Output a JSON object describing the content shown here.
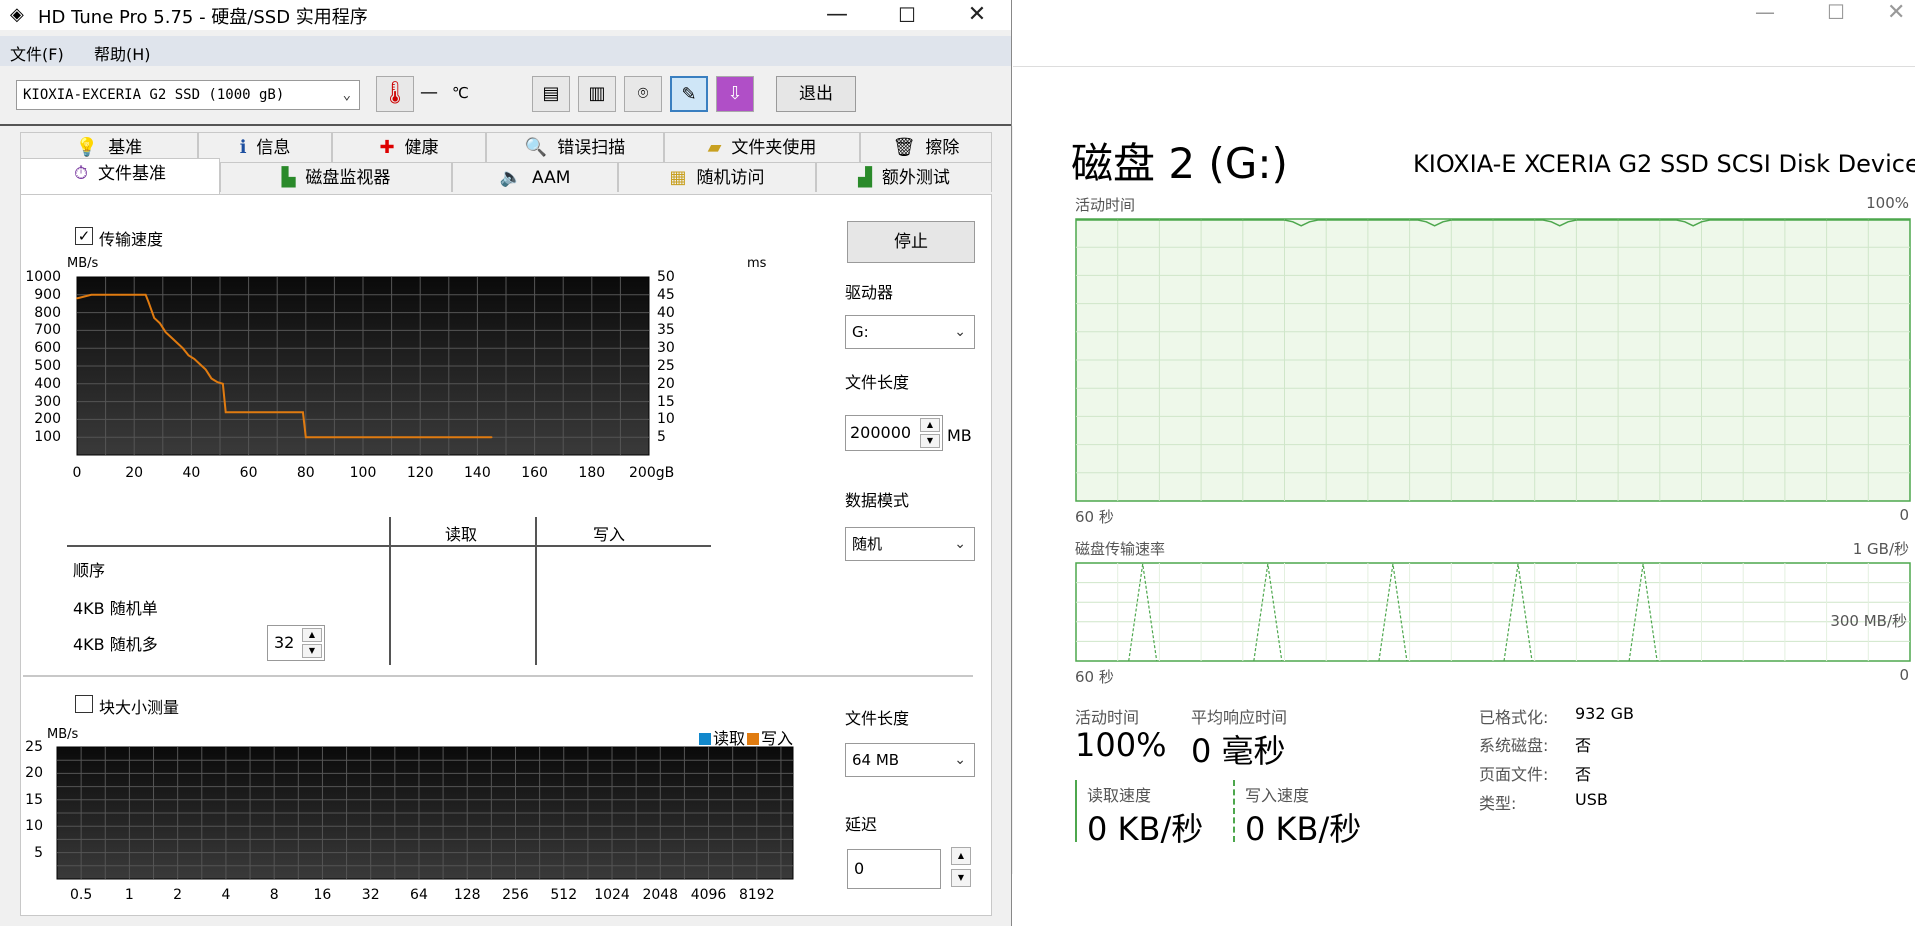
{
  "hdtune": {
    "title": "HD Tune Pro 5.75 - 硬盘/SSD 实用程序",
    "menu": [
      "文件(F)",
      "帮助(H)"
    ],
    "drive_select": "KIOXIA-EXCERIA G2 SSD (1000 gB)",
    "temp": "—",
    "exit_label": "退出",
    "tabs_row1": [
      {
        "label": "基准",
        "icon": "benchmark-icon"
      },
      {
        "label": "信息",
        "icon": "info-icon"
      },
      {
        "label": "健康",
        "icon": "health-icon"
      },
      {
        "label": "错误扫描",
        "icon": "error-scan-icon"
      },
      {
        "label": "文件夹使用",
        "icon": "folder-icon"
      },
      {
        "label": "擦除",
        "icon": "erase-icon"
      }
    ],
    "tabs_row2": [
      {
        "label": "文件基准",
        "icon": "file-benchmark-icon",
        "active": true
      },
      {
        "label": "磁盘监视器",
        "icon": "disk-monitor-icon"
      },
      {
        "label": "AAM",
        "icon": "speaker-icon"
      },
      {
        "label": "随机访问",
        "icon": "random-access-icon"
      },
      {
        "label": "额外测试",
        "icon": "extra-tests-icon"
      }
    ],
    "transfer_label": "传输速度",
    "transfer_checked": true,
    "chart_units_left": "MB/s",
    "chart_units_right": "ms",
    "y_ticks": [
      "1000",
      "900",
      "800",
      "700",
      "600",
      "500",
      "400",
      "300",
      "200",
      "100"
    ],
    "y2_ticks": [
      "50",
      "45",
      "40",
      "35",
      "30",
      "25",
      "20",
      "15",
      "10",
      "5"
    ],
    "x_ticks": [
      "0",
      "20",
      "40",
      "60",
      "80",
      "100",
      "120",
      "140",
      "160",
      "180",
      "200gB"
    ],
    "table_headers": [
      "读取",
      "写入"
    ],
    "rows": [
      "顺序",
      "4KB 随机单",
      "4KB 随机多"
    ],
    "queue_depth": "32",
    "stop_label": "停止",
    "drive_label": "驱动器",
    "drive_value": "G:",
    "file_length_label": "文件长度",
    "file_length_value": "200000",
    "file_length_unit": "MB",
    "data_mode_label": "数据模式",
    "data_mode_value": "随机",
    "block_label": "块大小测量",
    "block_checked": false,
    "block_units": "MB/s",
    "legend_read": "读取",
    "legend_write": "写入",
    "block_y_ticks": [
      "25",
      "20",
      "15",
      "10",
      "5"
    ],
    "block_x_ticks": [
      "0.5",
      "1",
      "2",
      "4",
      "8",
      "16",
      "32",
      "64",
      "128",
      "256",
      "512",
      "1024",
      "2048",
      "4096",
      "8192"
    ],
    "file_length2_label": "文件长度",
    "file_length2_value": "64 MB",
    "delay_label": "延迟",
    "delay_value": "0",
    "colors": {
      "write_line": "#e07b10",
      "read_legend": "#1188cc",
      "write_legend": "#e07b10"
    }
  },
  "chart_data": {
    "type": "line",
    "xlabel": "",
    "ylabel": "MB/s",
    "xlim": [
      0,
      200
    ],
    "ylim": [
      0,
      1000
    ],
    "series": [
      {
        "name": "写入",
        "x": [
          0,
          5,
          10,
          15,
          20,
          24,
          25,
          27,
          29,
          31,
          33,
          35,
          37,
          39,
          41,
          43,
          45,
          47,
          49,
          51,
          52,
          60,
          70,
          79,
          80,
          90,
          100,
          110,
          120,
          130,
          140,
          145
        ],
        "y": [
          880,
          900,
          900,
          900,
          900,
          900,
          860,
          770,
          740,
          690,
          660,
          630,
          600,
          560,
          540,
          510,
          480,
          430,
          410,
          400,
          240,
          240,
          240,
          240,
          100,
          100,
          100,
          100,
          100,
          100,
          100,
          100
        ]
      }
    ]
  },
  "taskmgr": {
    "disk_title": "磁盘 2 (G:)",
    "device_name": "KIOXIA-E XCERIA G2 SSD SCSI Disk Device",
    "activity_label": "活动时间",
    "activity_max": "100%",
    "time_left": "60 秒",
    "time_right": "0",
    "rate_label": "磁盘传输速率",
    "rate_max": "1 GB/秒",
    "rate_mid": "300 MB/秒",
    "time_left2": "60 秒",
    "time_right2": "0",
    "stat_active_label": "活动时间",
    "stat_active_value": "100%",
    "stat_resp_label": "平均响应时间",
    "stat_resp_value": "0 毫秒",
    "read_label": "读取速度",
    "read_value": "0 KB/秒",
    "write_label": "写入速度",
    "write_value": "0 KB/秒",
    "details": [
      {
        "k": "已格式化:",
        "v": "932 GB"
      },
      {
        "k": "系统磁盘:",
        "v": "否"
      },
      {
        "k": "页面文件:",
        "v": "否"
      },
      {
        "k": "类型:",
        "v": "USB"
      }
    ],
    "colors": {
      "graph_line": "#4da74d",
      "graph_fill": "#eef8ea"
    }
  }
}
